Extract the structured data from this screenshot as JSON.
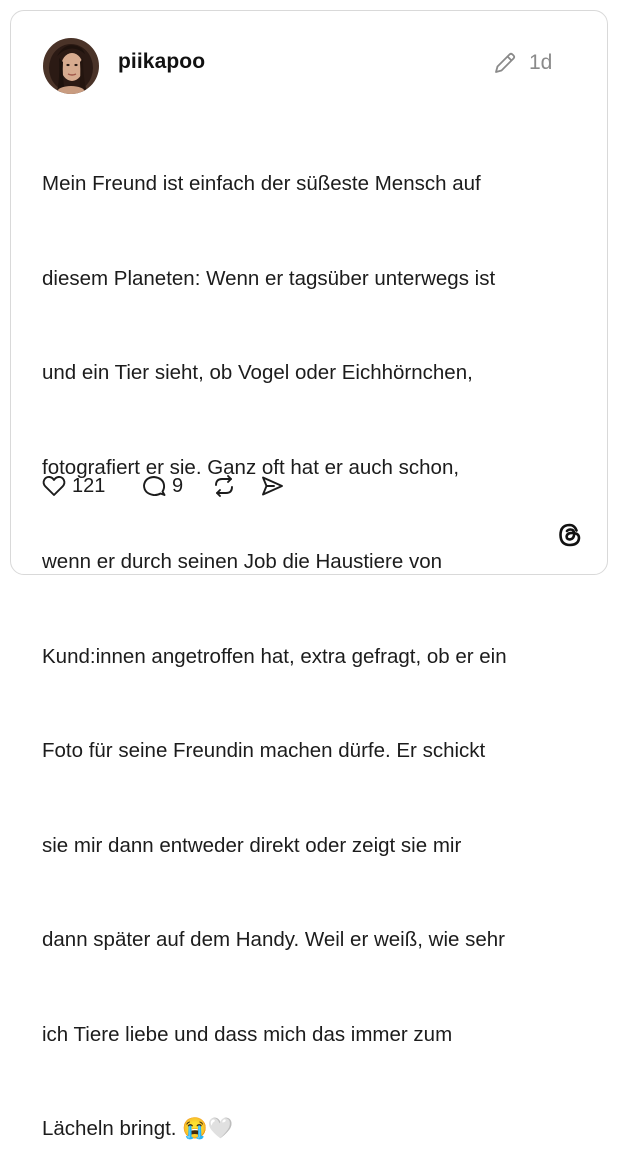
{
  "post": {
    "username": "piikapoo",
    "timestamp": "1d",
    "lines": [
      "Mein Freund ist einfach der süßeste Mensch auf",
      "diesem Planeten: Wenn er tagsüber unterwegs ist",
      "und ein Tier sieht, ob Vogel oder Eichhörnchen,",
      "fotografiert er sie. Ganz oft hat er auch schon,",
      "wenn er durch seinen Job die Haustiere von",
      "Kund:innen angetroffen hat, extra gefragt, ob er ein",
      "Foto für seine Freundin machen dürfe. Er schickt",
      "sie mir dann entweder direkt oder zeigt sie mir",
      "dann später auf dem Handy. Weil er weiß, wie sehr",
      "ich Tiere liebe und dass mich das immer zum",
      "Lächeln bringt. 😭🤍"
    ]
  },
  "actions": {
    "like_count": "121",
    "reply_count": "9"
  },
  "icons": {
    "edit": "pencil-icon",
    "like": "heart-icon",
    "reply": "comment-icon",
    "repost": "repost-icon",
    "share": "send-icon",
    "brand": "threads-logo-icon"
  },
  "colors": {
    "border": "#d9d9d9",
    "text": "#1c1c1c",
    "muted": "#8a8a8a"
  }
}
